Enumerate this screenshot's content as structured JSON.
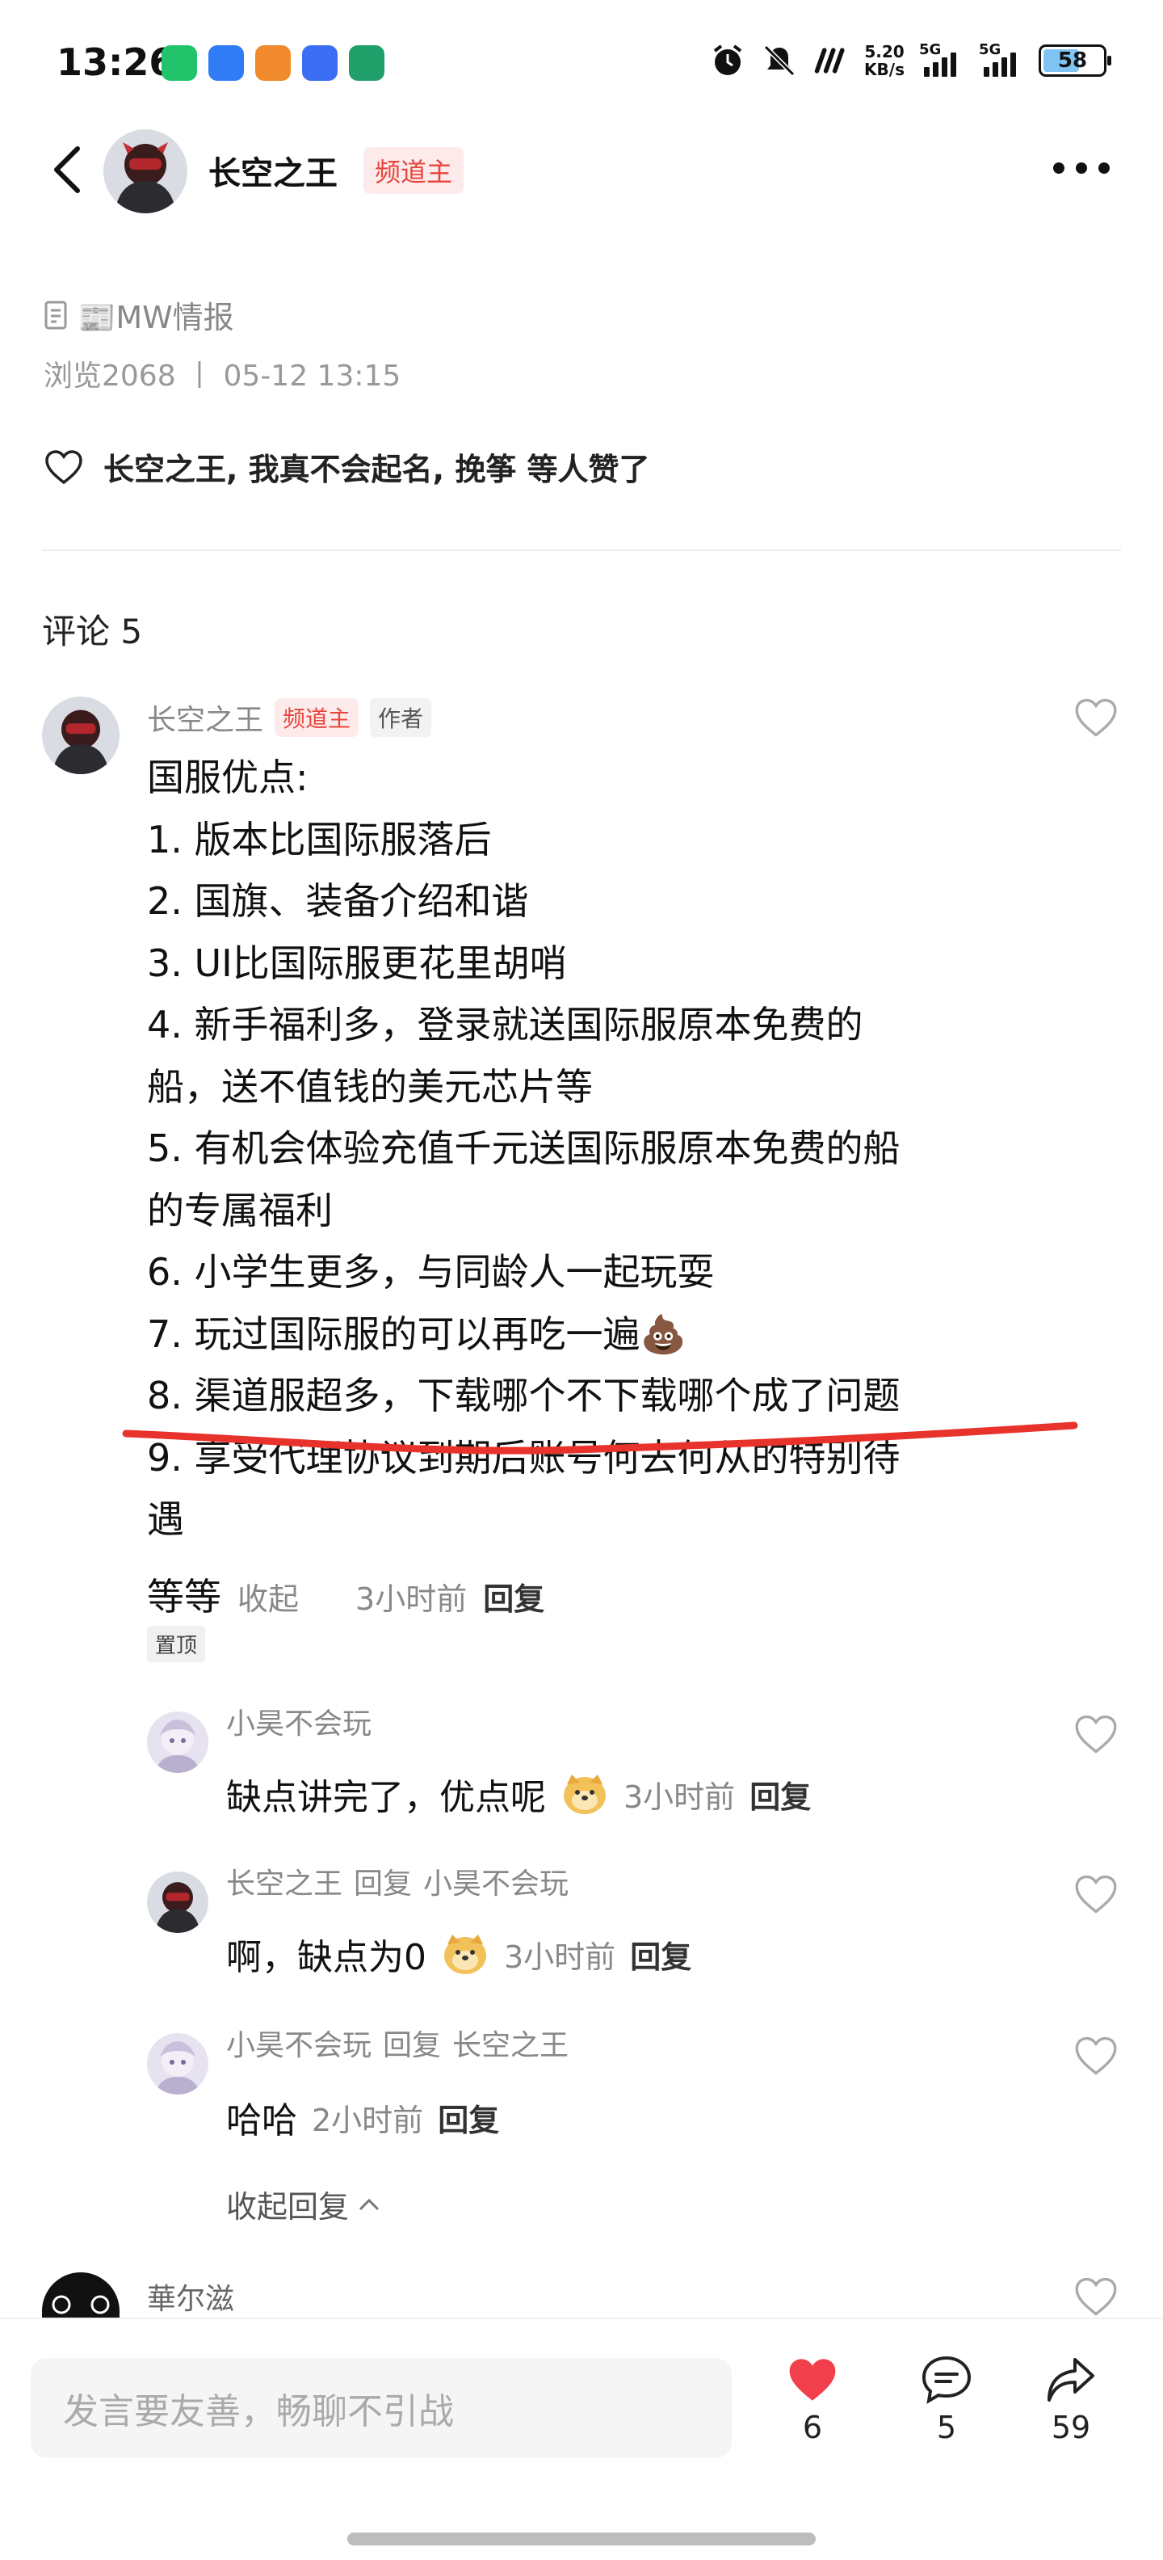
{
  "status_bar": {
    "time": "13:26",
    "net_speed_value": "5.20",
    "net_speed_unit": "KB/s",
    "sim1": "5G",
    "sim2": "5G",
    "battery": "58"
  },
  "header": {
    "author_name": "长空之王",
    "author_badge": "频道主"
  },
  "post": {
    "source": "📰MW情报",
    "stats": "浏览2068 丨 05-12 13:15",
    "likes_text": "长空之王, 我真不会起名, 挽筝 等人赞了"
  },
  "comments_title": "评论 5",
  "main_comment": {
    "author": "长空之王",
    "badge": "频道主",
    "author_tag": "作者",
    "lines": [
      "国服优点:",
      "1. 版本比国际服落后",
      "2. 国旗、装备介绍和谐",
      "3. UI比国际服更花里胡哨",
      "4. 新手福利多，登录就送国际服原本免费的",
      "船，送不值钱的美元芯片等",
      "5. 有机会体验充值千元送国际服原本免费的船",
      "的专属福利",
      "6. 小学生更多，与同龄人一起玩耍",
      "7. 玩过国际服的可以再吃一遍💩",
      "8. 渠道服超多，下载哪个不下载哪个成了问题",
      "9. 享受代理协议到期后账号何去何从的特别待",
      "遇"
    ],
    "tail_text": "等等",
    "collapse": "收起",
    "time": "3小时前",
    "reply": "回复",
    "pinned": "置顶"
  },
  "replies": [
    {
      "author": "小昊不会玩",
      "reply_to_word": "",
      "reply_to": "",
      "text": "缺点讲完了，优点呢",
      "time": "3小时前",
      "reply": "回复"
    },
    {
      "author": "长空之王",
      "reply_to_word": "回复",
      "reply_to": "小昊不会玩",
      "text": "啊，缺点为0",
      "time": "3小时前",
      "reply": "回复"
    },
    {
      "author": "小昊不会玩",
      "reply_to_word": "回复",
      "reply_to": "长空之王",
      "text": "哈哈",
      "time": "2小时前",
      "reply": "回复"
    }
  ],
  "collapse_replies": "收起回复",
  "next_comment_author": "華尔滋",
  "bottom_bar": {
    "input_placeholder": "发言要友善，畅聊不引战",
    "like_count": "6",
    "comment_count": "5",
    "share_count": "59",
    "like_color": "#f1404b"
  }
}
